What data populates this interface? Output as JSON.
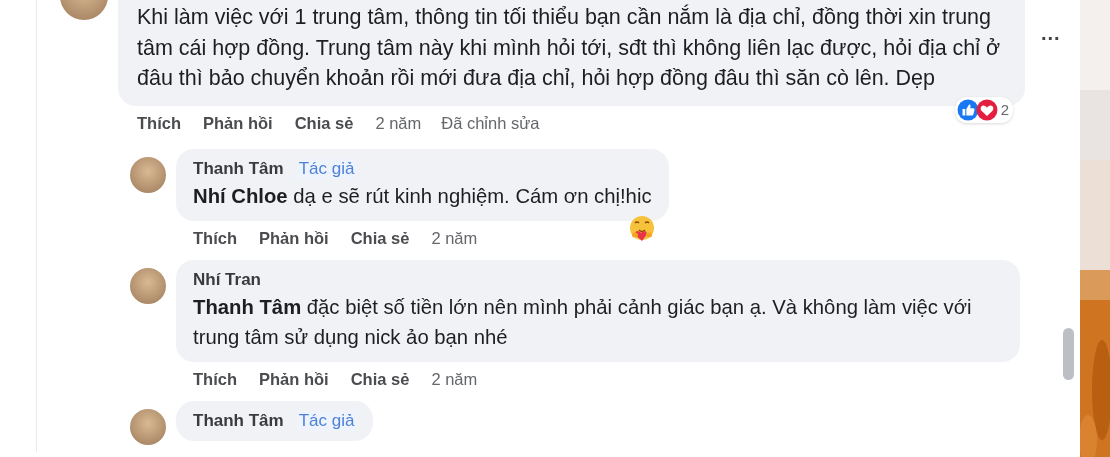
{
  "comment": {
    "text": "Khi làm việc với 1 trung tâm, thông tin tối thiểu bạn cần nắm là địa chỉ, đồng thời xin trung tâm cái hợp đồng. Trung tâm này khi mình hỏi tới, sđt thì không liên lạc được, hỏi địa chỉ ở đâu thì bảo chuyển khoản rồi mới đưa địa chỉ, hỏi hợp đồng đâu thì săn cò lên. Dẹp",
    "more": "...",
    "reactions": {
      "like": true,
      "love": true,
      "count": "2"
    },
    "actions": [
      "Thích",
      "Phản hồi",
      "Chia sẻ"
    ],
    "time": "2 năm",
    "edited": "Đã chỉnh sửa",
    "replies": [
      {
        "author": "Thanh Tâm",
        "badge": "Tác giả",
        "text": "**Nhí Chloe** dạ e sẽ rút kinh nghiệm. Cám ơn chị!hic",
        "emoji_reaction": true,
        "actions": [
          "Thích",
          "Phản hồi",
          "Chia sẻ"
        ],
        "time": "2 năm"
      },
      {
        "author": "Nhí Tran",
        "text": "**Thanh Tâm** đặc biệt số tiền lớn nên mình phải cảnh giác bạn ạ. Và không làm việc với trung tâm sử dụng nick ảo bạn nhé",
        "emoji_reaction": false,
        "actions": [
          "Thích",
          "Phản hồi",
          "Chia sẻ"
        ],
        "time": "2 năm"
      },
      {
        "author": "Thanh Tâm",
        "badge": "Tác giả"
      }
    ]
  }
}
